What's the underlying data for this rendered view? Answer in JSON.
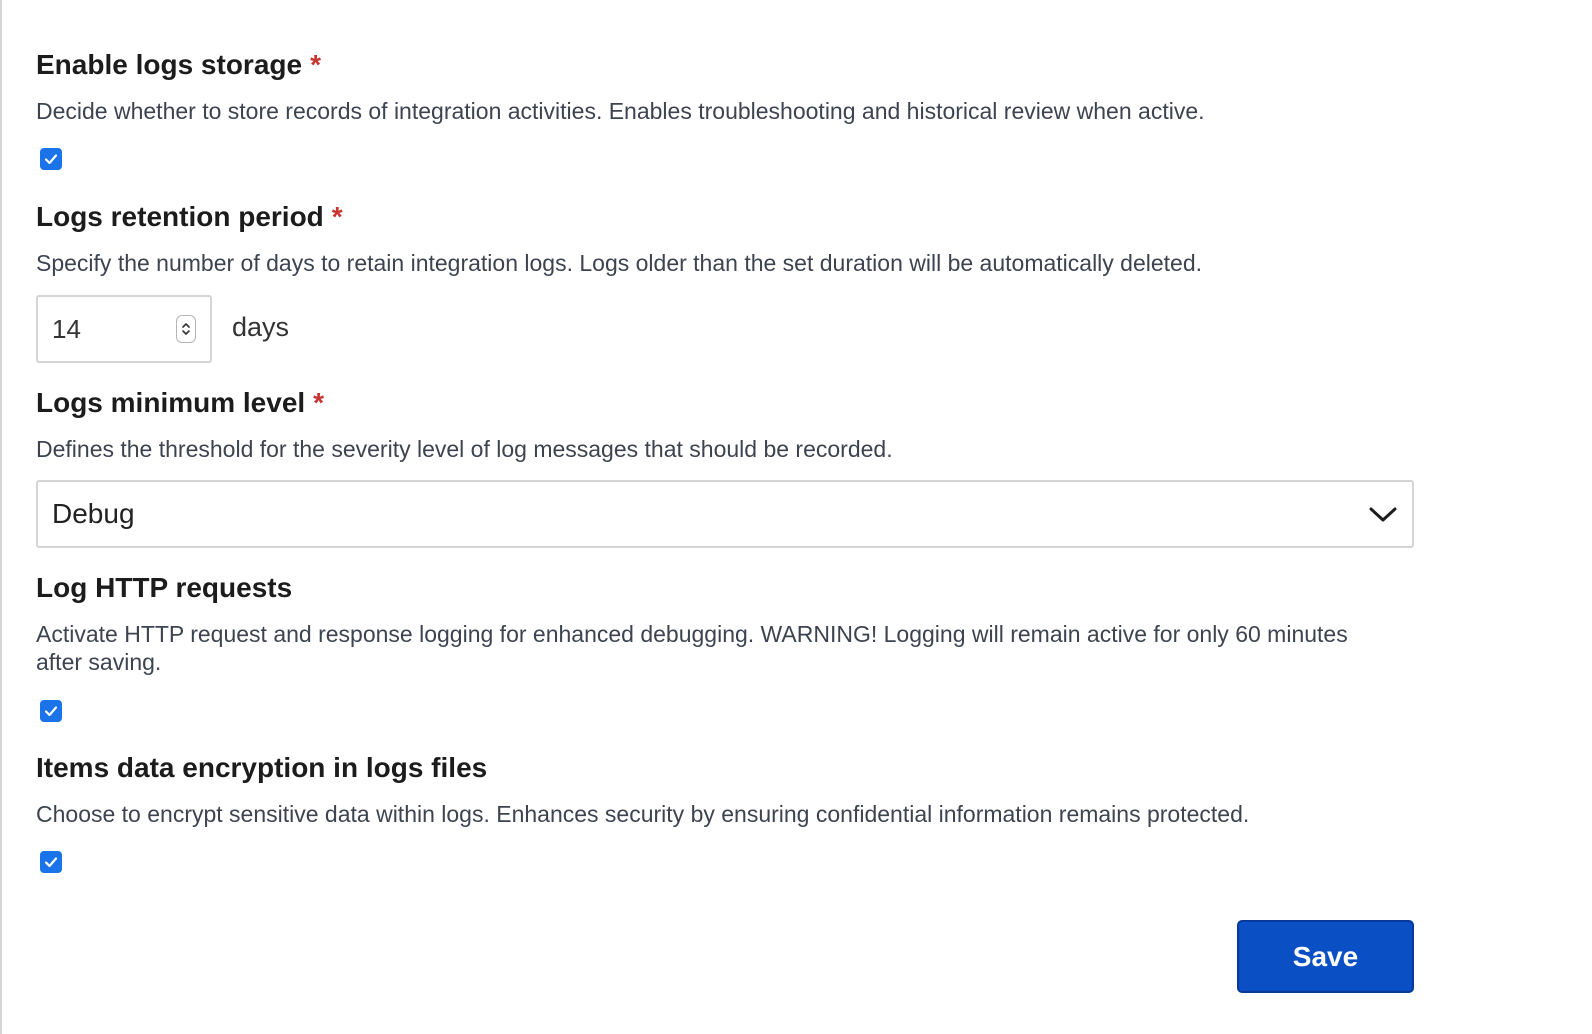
{
  "fields": {
    "logs_storage": {
      "title": "Enable logs storage",
      "required_mark": "*",
      "description": "Decide whether to store records of integration activities. Enables troubleshooting and historical review when active.",
      "checked": true
    },
    "retention": {
      "title": "Logs retention period",
      "required_mark": "*",
      "description": "Specify the number of days to retain integration logs. Logs older than the set duration will be automatically deleted.",
      "value": "14",
      "unit": "days"
    },
    "min_level": {
      "title": "Logs minimum level",
      "required_mark": "*",
      "description": "Defines the threshold for the severity level of log messages that should be recorded.",
      "selected": "Debug"
    },
    "http_requests": {
      "title": "Log HTTP requests",
      "description": "Activate HTTP request and response logging for enhanced debugging. WARNING! Logging will remain active for only 60 minutes after saving.",
      "checked": true
    },
    "encryption": {
      "title": "Items data encryption in logs files",
      "description": "Choose to encrypt sensitive data within logs. Enhances security by ensuring confidential information remains protected.",
      "checked": true
    }
  },
  "actions": {
    "save_label": "Save"
  },
  "colors": {
    "accent": "#1a73e8",
    "required": "#c8342f",
    "save_button": "#0a4fc4"
  },
  "icons": {
    "checkbox": "checkmark-icon",
    "stepper": "spinner-arrows-icon",
    "select": "chevron-down-icon"
  }
}
